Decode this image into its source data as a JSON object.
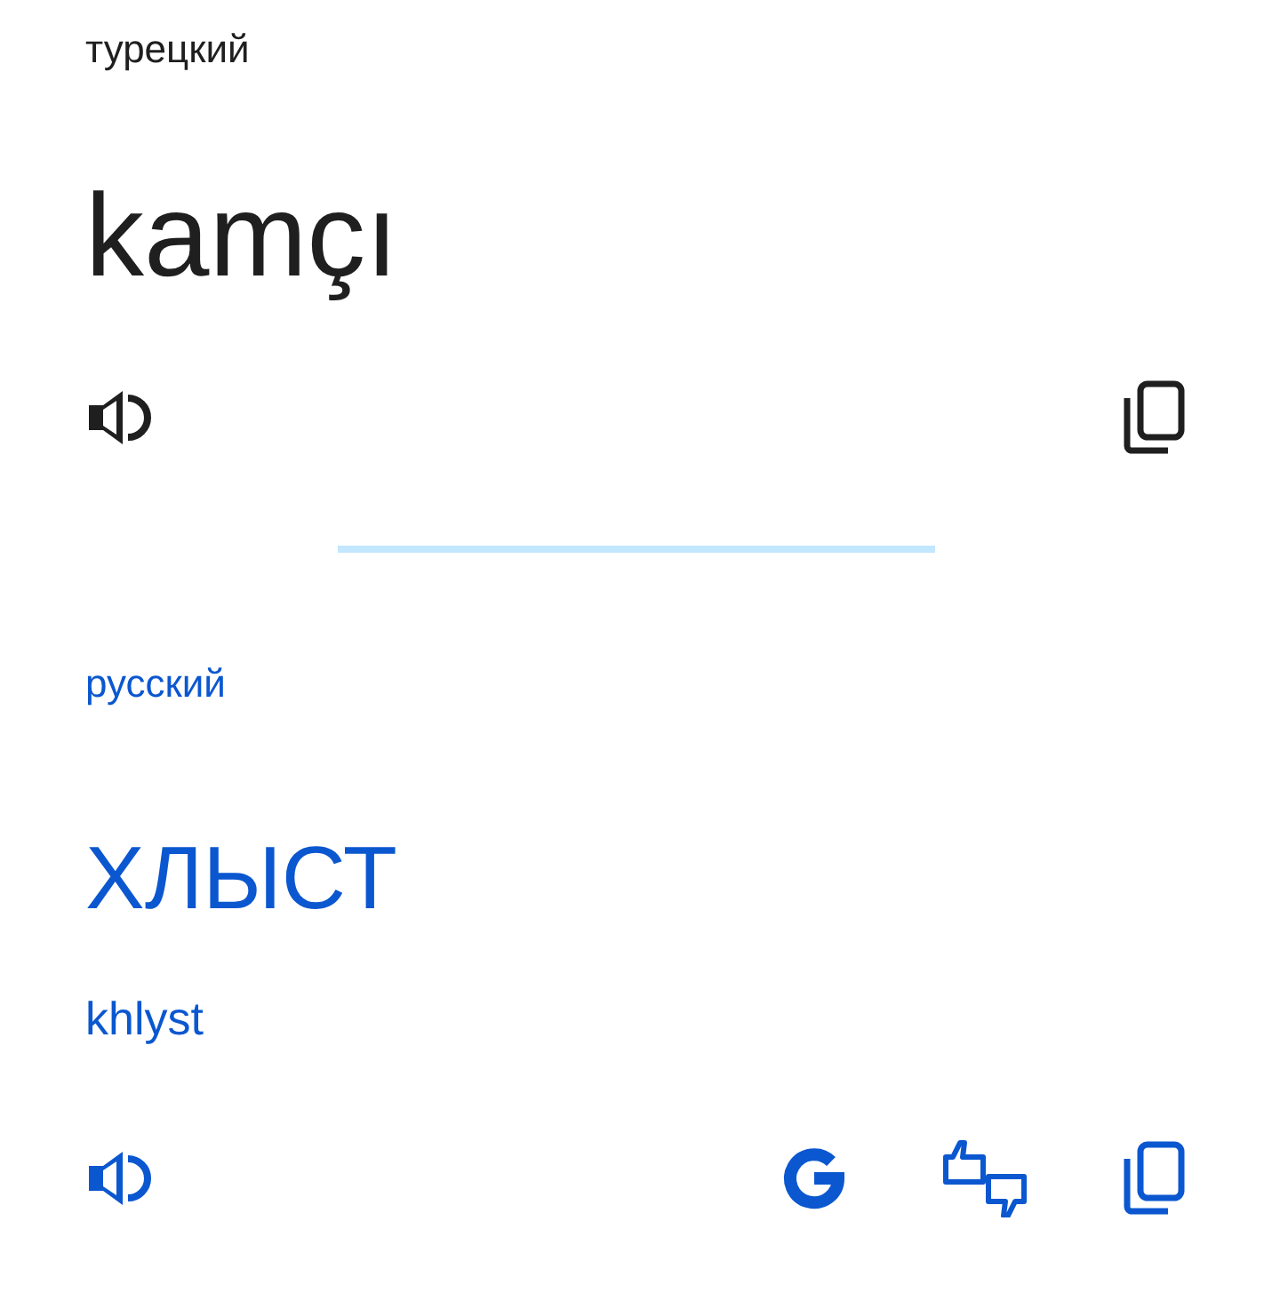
{
  "source": {
    "language": "турецкий",
    "text": "kamçı"
  },
  "target": {
    "language": "русский",
    "text": "ХЛЫСТ",
    "transliteration": "khlyst"
  }
}
